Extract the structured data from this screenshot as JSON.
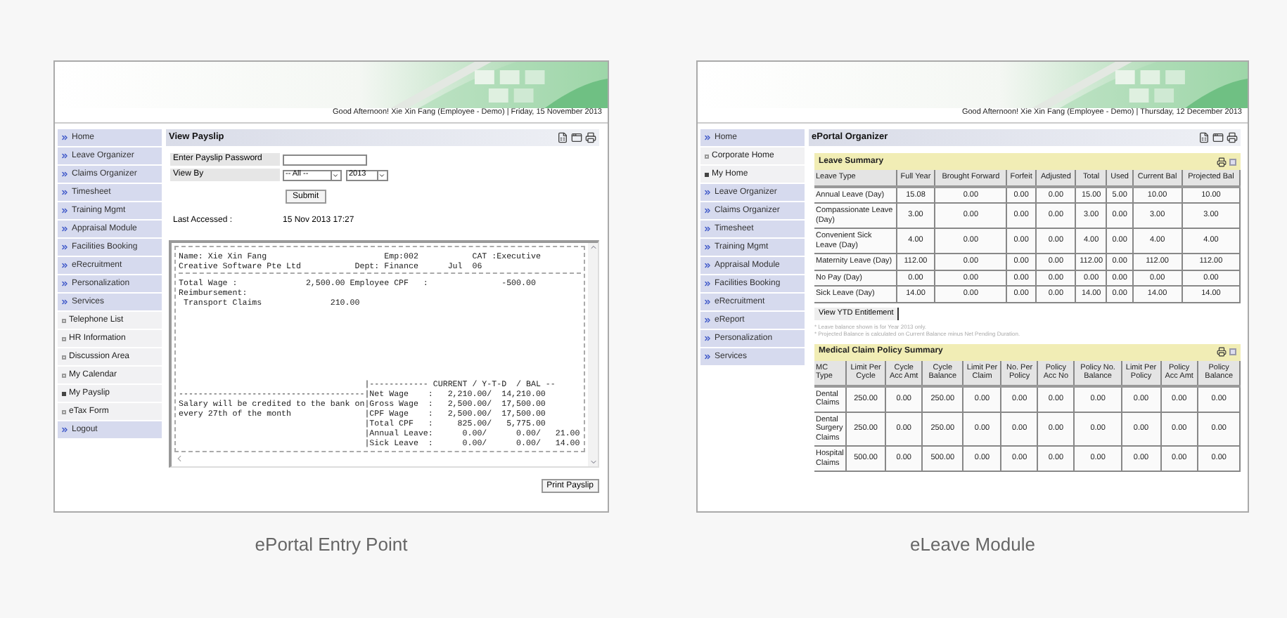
{
  "screenshots": [
    {
      "kind": "payslip",
      "greeting": "Good Afternoon! Xie Xin Fang (Employee - Demo) | Friday, 15 November 2013",
      "sidebar": [
        {
          "kind": "menu",
          "label": "Home",
          "selected": false
        },
        {
          "kind": "menu",
          "label": "Leave Organizer",
          "selected": false
        },
        {
          "kind": "menu",
          "label": "Claims Organizer",
          "selected": false
        },
        {
          "kind": "menu",
          "label": "Timesheet",
          "selected": false
        },
        {
          "kind": "menu",
          "label": "Training Mgmt",
          "selected": false
        },
        {
          "kind": "menu",
          "label": "Appraisal Module",
          "selected": false
        },
        {
          "kind": "menu",
          "label": "Facilities Booking",
          "selected": false
        },
        {
          "kind": "menu",
          "label": "eRecruitment",
          "selected": false
        },
        {
          "kind": "menu",
          "label": "Personalization",
          "selected": false
        },
        {
          "kind": "menu",
          "label": "Services",
          "selected": false
        },
        {
          "kind": "sub",
          "label": "Telephone List",
          "selected": false
        },
        {
          "kind": "sub",
          "label": "HR Information",
          "selected": false
        },
        {
          "kind": "sub",
          "label": "Discussion Area",
          "selected": false
        },
        {
          "kind": "sub",
          "label": "My Calendar",
          "selected": false
        },
        {
          "kind": "sub",
          "label": "My Payslip",
          "selected": true
        },
        {
          "kind": "sub",
          "label": "eTax Form",
          "selected": false
        },
        {
          "kind": "menu",
          "label": "Logout",
          "selected": false
        }
      ],
      "title": "View Payslip",
      "form": {
        "password_label": "Enter Payslip Password",
        "view_by_label": "View By",
        "period": "-- All --",
        "year": "2013",
        "submit": "Submit",
        "last_accessed_label": "Last Accessed :",
        "last_accessed": "15 Nov 2013 17:27"
      },
      "payslip": {
        "head": [
          "Name: Xie Xin Fang                        Emp:002           CAT :Executive",
          "Creative Software Pte Ltd           Dept: Finance      Jul  06"
        ],
        "body": [
          "Total Wage :              2,500.00 Employee CPF   :               -500.00",
          "Reimbursement:",
          " Transport Claims              210.00"
        ],
        "summary": [
          "                                      |------------ CURRENT / Y-T-D  / BAL --",
          "--------------------------------------|Net Wage    :   2,210.00/  14,210.00",
          "Salary will be credited to the bank on|Gross Wage  :   2,500.00/  17,500.00",
          "every 27th of the month               |CPF Wage    :   2,500.00/  17,500.00",
          "                                      |Total CPF   :     825.00/   5,775.00",
          "                                      |Annual Leave:      0.00/      0.00/   21.00",
          "                                      |Sick Leave  :      0.00/      0.00/   14.00"
        ]
      },
      "print_button": "Print Payslip",
      "caption": "ePortal Entry Point"
    },
    {
      "kind": "leave",
      "greeting": "Good Afternoon! Xie Xin Fang (Employee - Demo) | Thursday, 12 December 2013",
      "sidebar": [
        {
          "kind": "menu",
          "label": "Home",
          "selected": false
        },
        {
          "kind": "sub",
          "label": "Corporate Home",
          "selected": false
        },
        {
          "kind": "sub",
          "label": "My Home",
          "selected": true
        },
        {
          "kind": "menu",
          "label": "Leave Organizer",
          "selected": false
        },
        {
          "kind": "menu",
          "label": "Claims Organizer",
          "selected": false
        },
        {
          "kind": "menu",
          "label": "Timesheet",
          "selected": false
        },
        {
          "kind": "menu",
          "label": "Training Mgmt",
          "selected": false
        },
        {
          "kind": "menu",
          "label": "Appraisal Module",
          "selected": false
        },
        {
          "kind": "menu",
          "label": "Facilities Booking",
          "selected": false
        },
        {
          "kind": "menu",
          "label": "eRecruitment",
          "selected": false
        },
        {
          "kind": "menu",
          "label": "eReport",
          "selected": false
        },
        {
          "kind": "menu",
          "label": "Personalization",
          "selected": false
        },
        {
          "kind": "menu",
          "label": "Services",
          "selected": false
        }
      ],
      "title": "ePortal Organizer",
      "sections": [
        {
          "title": "Leave Summary",
          "columns": [
            "Leave Type",
            "Full Year",
            "Brought Forward",
            "Forfeit",
            "Adjusted",
            "Total",
            "Used",
            "Current Bal",
            "Projected Bal"
          ],
          "rows": [
            [
              "Annual Leave (Day)",
              "15.08",
              "0.00",
              "0.00",
              "0.00",
              "15.00",
              "5.00",
              "10.00",
              "10.00"
            ],
            [
              "Compassionate Leave (Day)",
              "3.00",
              "0.00",
              "0.00",
              "0.00",
              "3.00",
              "0.00",
              "3.00",
              "3.00"
            ],
            [
              "Convenient Sick Leave (Day)",
              "4.00",
              "0.00",
              "0.00",
              "0.00",
              "4.00",
              "0.00",
              "4.00",
              "4.00"
            ],
            [
              "Maternity Leave (Day)",
              "112.00",
              "0.00",
              "0.00",
              "0.00",
              "112.00",
              "0.00",
              "112.00",
              "112.00"
            ],
            [
              "No Pay (Day)",
              "0.00",
              "0.00",
              "0.00",
              "0.00",
              "0.00",
              "0.00",
              "0.00",
              "0.00"
            ],
            [
              "Sick Leave (Day)",
              "14.00",
              "0.00",
              "0.00",
              "0.00",
              "14.00",
              "0.00",
              "14.00",
              "14.00"
            ]
          ],
          "button": "View YTD Entitlement",
          "notes": [
            "* Leave balance shown is for Year 2013 only.",
            "* Projected Balance is calculated on Current Balance minus Net Pending Duration."
          ]
        },
        {
          "title": "Medical Claim Policy Summary",
          "columns": [
            "MC Type",
            "Limit Per Cycle",
            "Cycle Acc Amt",
            "Cycle Balance",
            "Limit Per Claim",
            "No. Per Policy",
            "Policy Acc No",
            "Policy No. Balance",
            "Limit Per Policy",
            "Policy Acc Amt",
            "Policy Balance"
          ],
          "rows": [
            [
              "Dental Claims",
              "250.00",
              "0.00",
              "250.00",
              "0.00",
              "0.00",
              "0.00",
              "0.00",
              "0.00",
              "0.00",
              "0.00"
            ],
            [
              "Dental Surgery Claims",
              "250.00",
              "0.00",
              "250.00",
              "0.00",
              "0.00",
              "0.00",
              "0.00",
              "0.00",
              "0.00",
              "0.00"
            ],
            [
              "Hospital Claims",
              "500.00",
              "0.00",
              "500.00",
              "0.00",
              "0.00",
              "0.00",
              "0.00",
              "0.00",
              "0.00",
              "0.00"
            ]
          ]
        }
      ],
      "caption": "eLeave Module"
    }
  ]
}
